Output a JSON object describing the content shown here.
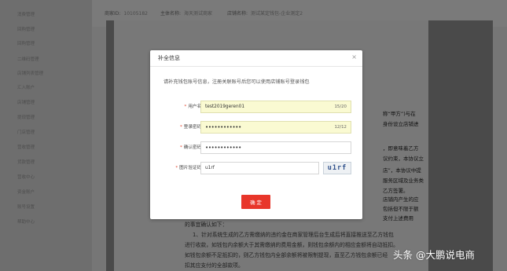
{
  "sidebar": {
    "items": [
      "消费管理",
      "回购管理",
      "回购管理",
      "二维码管理",
      "店铺列表管理",
      "汇入账户",
      "店铺管理",
      "提现管理",
      "门店管理",
      "营收管理",
      "货款管理",
      "营收中心",
      "资金账户",
      "账号设置",
      "帮助中心"
    ]
  },
  "infobar": {
    "merchant_id_label": "商家ID:",
    "merchant_id": "10105182",
    "merchant_name_label": "主体名称:",
    "merchant_name": "海天测试商家",
    "store_label": "店铺名称:",
    "store_name": "测试某定钱包-企业测定2"
  },
  "document": {
    "lines_right": [
      "称“甲方”)与在",
      "身份设立店铺进",
      "，即意味着乙方",
      "议约束，本协议立",
      "店”，本协议中提",
      "服务区域及业务类",
      "乙方签署。",
      "店铺内产生的应",
      "包括但不限于额",
      "支付上述费用"
    ],
    "lines_bottom": [
      "的事宜确认如下：",
      "1、针对系统生成的乙方需缴纳的违约金在商家管理后台生成后将直接推送至乙方钱包",
      "进行收款，如钱包内余额大于其需缴纳的费用金额，则钱包余额内的相应金额将自动抵扣。",
      "如钱包余额不足抵扣的，则乙方钱包内全部余额将被限制提现，直至乙方钱包余额已经",
      "扣其应支付的全部款项。"
    ]
  },
  "dialog": {
    "title": "补全信息",
    "close_icon": "×",
    "description": "请补充钱包账号信息，注册关联账号后您可以使用店铺账号登录钱包",
    "fields": {
      "username": {
        "label": "用户名:",
        "value": "test2019geren01",
        "counter": "15/20"
      },
      "password": {
        "label": "登录密码:",
        "value": "••••••••••••",
        "counter": "12/12"
      },
      "confirm_password": {
        "label": "确认密码:",
        "value": "••••••••••••"
      },
      "captcha": {
        "label": "图片验证码:",
        "value": "u1rf",
        "image_text": "u1rf"
      }
    },
    "confirm_label": "确 定"
  },
  "watermark": "头条 @大鹏说电商",
  "colors": {
    "accent": "#e8362a",
    "filled_input": "#fafad2"
  }
}
